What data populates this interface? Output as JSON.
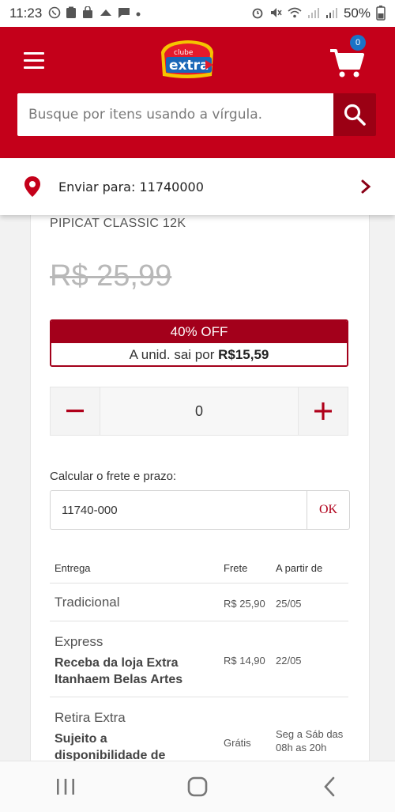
{
  "status_bar": {
    "time": "11:23",
    "battery": "50%",
    "left_icons": [
      "whatsapp-icon",
      "clipboard-icon",
      "shop-icon",
      "cloud-icon",
      "chat-icon",
      "dot-icon"
    ],
    "right_icons": [
      "alarm-icon",
      "mute-icon",
      "wifi-icon",
      "signal-icon",
      "signal-icon"
    ]
  },
  "header": {
    "brand_top": "clube",
    "brand_main": "extra",
    "cart_count": "0",
    "search": {
      "placeholder": "Busque por itens usando a vírgula."
    }
  },
  "delivery": {
    "label": "Enviar para: 11740000"
  },
  "product": {
    "name": "PIPICAT CLASSIC 12K",
    "old_price": "R$ 25,99",
    "discount": "40% OFF",
    "unit_text": "A unid. sai por ",
    "unit_price": "R$15,59",
    "quantity": "0",
    "minus": "−",
    "plus": "+"
  },
  "freight": {
    "label": "Calcular o frete e prazo:",
    "cep_value": "11740-000",
    "ok_label": "OK",
    "columns": [
      "Entrega",
      "Frete",
      "A partir de"
    ],
    "rows": [
      {
        "type": "Tradicional",
        "detail": "",
        "price": "R$ 25,90",
        "date": "25/05"
      },
      {
        "type": "Express",
        "detail": "Receba da loja Extra Itanhaem Belas Artes",
        "price": "R$ 14,90",
        "date": "22/05"
      },
      {
        "type": "Retira Extra",
        "detail": "Sujeito a disponibilidade de",
        "price": "Grátis",
        "date": "Seg a Sáb das 08h as 20h"
      }
    ]
  },
  "colors": {
    "brand_red": "#c4001a",
    "dark_red": "#9b0014",
    "badge_blue": "#1a73c7"
  }
}
